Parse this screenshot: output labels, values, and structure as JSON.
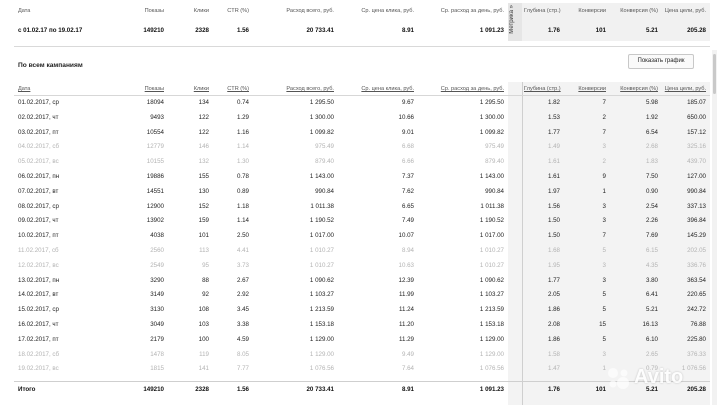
{
  "summary": {
    "headers": [
      "Дата",
      "Показы",
      "Клики",
      "CTR (%)",
      "Расход всего, руб.",
      "Ср. цена клика, руб.",
      "Ср. расход за день, руб.",
      "Глубина (стр.)",
      "Конверсии",
      "Конверсия (%)",
      "Цена цели, руб."
    ],
    "metrika_label": "Метрика »",
    "row": [
      "с 01.02.17 по 19.02.17",
      "149210",
      "2328",
      "1.56",
      "20 733.41",
      "8.91",
      "1 091.23",
      "1.76",
      "101",
      "5.21",
      "205.28"
    ]
  },
  "section": {
    "title": "По всем кампаниям",
    "graph_button": "Показать график"
  },
  "table": {
    "headers": [
      "Дата",
      "Показы",
      "Клики",
      "CTR (%)",
      "Расход всего, руб.",
      "Ср. цена клика, руб.",
      "Ср. расход за день, руб.",
      "Глубина (стр.)",
      "Конверсии",
      "Конверсия (%)",
      "Цена цели, руб."
    ],
    "rows": [
      {
        "dim": false,
        "cells": [
          "01.02.2017, ср",
          "18094",
          "134",
          "0.74",
          "1 295.50",
          "9.67",
          "1 295.50",
          "1.82",
          "7",
          "5.98",
          "185.07"
        ]
      },
      {
        "dim": false,
        "cells": [
          "02.02.2017, чт",
          "9493",
          "122",
          "1.29",
          "1 300.00",
          "10.66",
          "1 300.00",
          "1.53",
          "2",
          "1.92",
          "650.00"
        ]
      },
      {
        "dim": false,
        "cells": [
          "03.02.2017, пт",
          "10554",
          "122",
          "1.16",
          "1 099.82",
          "9.01",
          "1 099.82",
          "1.77",
          "7",
          "6.54",
          "157.12"
        ]
      },
      {
        "dim": true,
        "cells": [
          "04.02.2017, сб",
          "12779",
          "146",
          "1.14",
          "975.49",
          "6.68",
          "975.49",
          "1.49",
          "3",
          "2.68",
          "325.16"
        ]
      },
      {
        "dim": true,
        "cells": [
          "05.02.2017, вс",
          "10155",
          "132",
          "1.30",
          "879.40",
          "6.66",
          "879.40",
          "1.61",
          "2",
          "1.83",
          "439.70"
        ]
      },
      {
        "dim": false,
        "cells": [
          "06.02.2017, пн",
          "19886",
          "155",
          "0.78",
          "1 143.00",
          "7.37",
          "1 143.00",
          "1.61",
          "9",
          "7.50",
          "127.00"
        ]
      },
      {
        "dim": false,
        "cells": [
          "07.02.2017, вт",
          "14551",
          "130",
          "0.89",
          "990.84",
          "7.62",
          "990.84",
          "1.97",
          "1",
          "0.90",
          "990.84"
        ]
      },
      {
        "dim": false,
        "cells": [
          "08.02.2017, ср",
          "12900",
          "152",
          "1.18",
          "1 011.38",
          "6.65",
          "1 011.38",
          "1.56",
          "3",
          "2.54",
          "337.13"
        ]
      },
      {
        "dim": false,
        "cells": [
          "09.02.2017, чт",
          "13902",
          "159",
          "1.14",
          "1 190.52",
          "7.49",
          "1 190.52",
          "1.50",
          "3",
          "2.26",
          "396.84"
        ]
      },
      {
        "dim": false,
        "cells": [
          "10.02.2017, пт",
          "4038",
          "101",
          "2.50",
          "1 017.00",
          "10.07",
          "1 017.00",
          "1.50",
          "7",
          "7.69",
          "145.29"
        ]
      },
      {
        "dim": true,
        "cells": [
          "11.02.2017, сб",
          "2560",
          "113",
          "4.41",
          "1 010.27",
          "8.94",
          "1 010.27",
          "1.68",
          "5",
          "6.15",
          "202.05"
        ]
      },
      {
        "dim": true,
        "cells": [
          "12.02.2017, вс",
          "2549",
          "95",
          "3.73",
          "1 010.27",
          "10.63",
          "1 010.27",
          "1.95",
          "3",
          "4.35",
          "336.76"
        ]
      },
      {
        "dim": false,
        "cells": [
          "13.02.2017, пн",
          "3290",
          "88",
          "2.67",
          "1 090.62",
          "12.39",
          "1 090.62",
          "1.77",
          "3",
          "3.80",
          "363.54"
        ]
      },
      {
        "dim": false,
        "cells": [
          "14.02.2017, вт",
          "3149",
          "92",
          "2.92",
          "1 103.27",
          "11.99",
          "1 103.27",
          "2.05",
          "5",
          "6.41",
          "220.65"
        ]
      },
      {
        "dim": false,
        "cells": [
          "15.02.2017, ср",
          "3130",
          "108",
          "3.45",
          "1 213.59",
          "11.24",
          "1 213.59",
          "1.86",
          "5",
          "5.21",
          "242.72"
        ]
      },
      {
        "dim": false,
        "cells": [
          "16.02.2017, чт",
          "3049",
          "103",
          "3.38",
          "1 153.18",
          "11.20",
          "1 153.18",
          "2.08",
          "15",
          "16.13",
          "76.88"
        ]
      },
      {
        "dim": false,
        "cells": [
          "17.02.2017, пт",
          "2179",
          "100",
          "4.59",
          "1 129.00",
          "11.29",
          "1 129.00",
          "1.86",
          "5",
          "6.10",
          "225.80"
        ]
      },
      {
        "dim": true,
        "cells": [
          "18.02.2017, сб",
          "1478",
          "119",
          "8.05",
          "1 129.00",
          "9.49",
          "1 129.00",
          "1.58",
          "3",
          "2.65",
          "376.33"
        ]
      },
      {
        "dim": true,
        "cells": [
          "19.02.2017, вс",
          "1815",
          "141",
          "7.77",
          "1 076.56",
          "7.64",
          "1 076.56",
          "1.47",
          "1",
          "0.79",
          "1 076.56"
        ]
      }
    ],
    "total": [
      "Итого",
      "149210",
      "2328",
      "1.56",
      "20 733.41",
      "8.91",
      "1 091.23",
      "1.76",
      "101",
      "5.21",
      "205.28"
    ]
  },
  "watermark": "Avito",
  "colors": {
    "dim_text": "#b3b3b3",
    "highlight_bg": "#f1f1f1"
  }
}
